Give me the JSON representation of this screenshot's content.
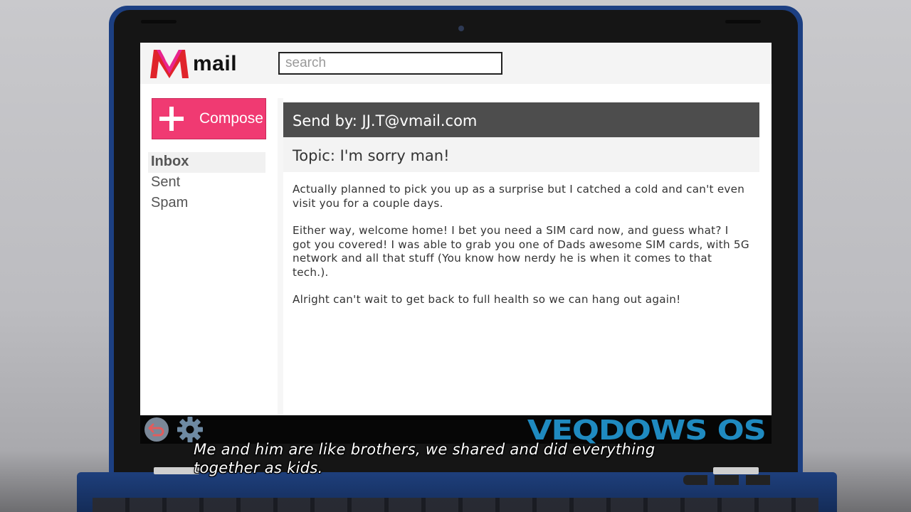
{
  "app": {
    "logo_text": "mail",
    "search_placeholder": "search",
    "compose_label": "Compose",
    "brand_color": "#f03a72"
  },
  "sidebar": {
    "items": [
      {
        "label": "Inbox",
        "active": true
      },
      {
        "label": "Sent",
        "active": false
      },
      {
        "label": "Spam",
        "active": false
      }
    ]
  },
  "email": {
    "sender": "Send by: JJ.T@vmail.com",
    "topic": "Topic: I'm sorry man!",
    "paragraphs": [
      "Actually planned to pick you up as a surprise but I catched a cold and can't even visit you for a couple days.",
      "Either way, welcome home! I bet you need a SIM card now, and guess what? I got you covered! I was able to grab you one of Dads awesome SIM cards, with 5G network and all that stuff (You know how nerdy he is when it comes to that tech.).",
      "Alright can't wait to get back to full health so we can hang out again!"
    ]
  },
  "taskbar": {
    "os_name": "VEQDOWS OS",
    "icons": [
      "back-arrow-icon",
      "gear-icon"
    ]
  },
  "subtitle": {
    "line1": "Me and him are like brothers, we shared and did everything",
    "line2": "together as kids."
  }
}
